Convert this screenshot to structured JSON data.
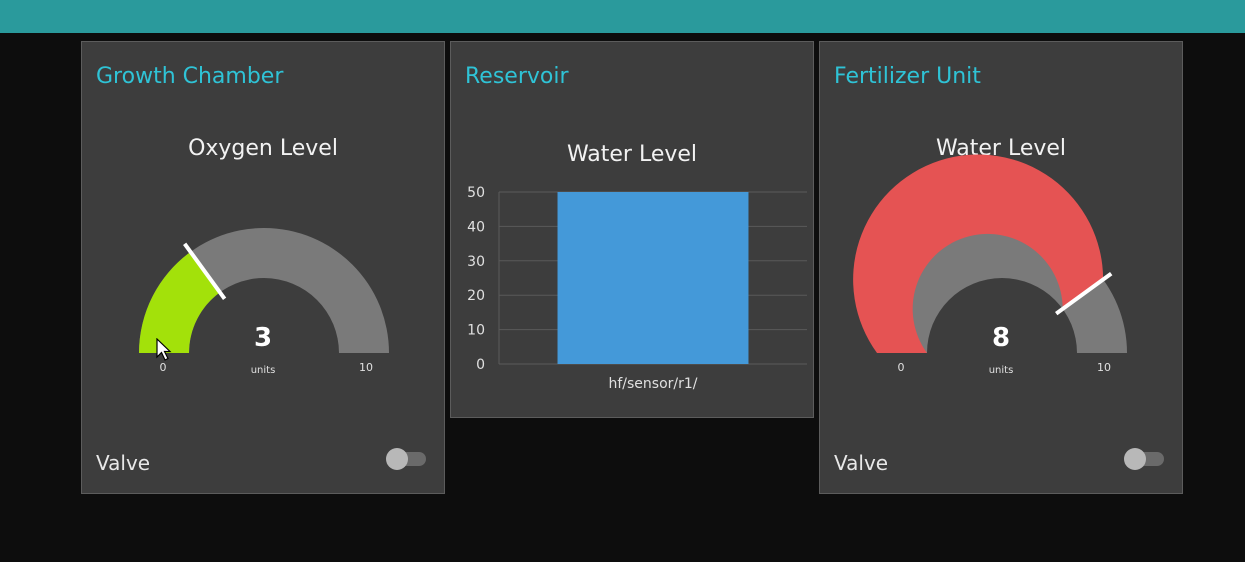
{
  "colors": {
    "header": "#2a9a9c",
    "card_title": "#2fc3d6",
    "oxygen_fill": "#a3e10a",
    "fertilizer_fill": "#e55353",
    "gauge_track": "#7a7a7a",
    "bar_fill": "#4499d9"
  },
  "cards": {
    "growth": {
      "title": "Growth Chamber",
      "gauge": {
        "label": "Oxygen Level",
        "value": 3,
        "units": "units",
        "min": 0,
        "max": 10,
        "min_label": "0",
        "max_label": "10",
        "value_label": "3"
      },
      "valve": {
        "label": "Valve",
        "on": false
      }
    },
    "reservoir": {
      "title": "Reservoir",
      "chart_title": "Water Level"
    },
    "fertilizer": {
      "title": "Fertilizer Unit",
      "gauge": {
        "label": "Water Level",
        "value": 8,
        "units": "units",
        "min": 0,
        "max": 10,
        "min_label": "0",
        "max_label": "10",
        "value_label": "8"
      },
      "valve": {
        "label": "Valve",
        "on": false
      }
    }
  },
  "chart_data": {
    "type": "bar",
    "title": "Water Level",
    "categories": [
      "hf/sensor/r1/"
    ],
    "values": [
      50
    ],
    "ylim": [
      0,
      50
    ],
    "yticks": [
      0,
      10,
      20,
      30,
      40,
      50
    ],
    "xlabel": "",
    "ylabel": "",
    "grid": true
  }
}
